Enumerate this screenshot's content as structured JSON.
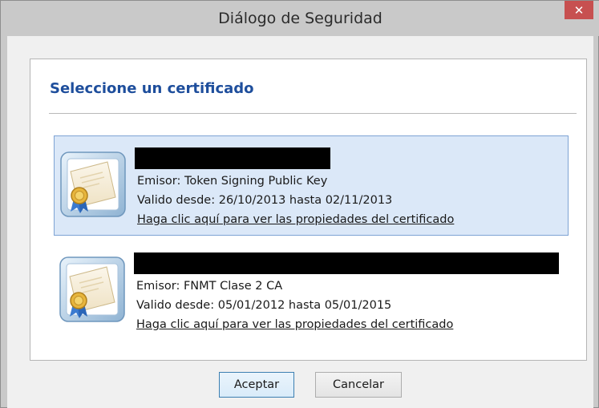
{
  "window": {
    "title": "Diálogo de Seguridad",
    "close_label": "✕"
  },
  "panel": {
    "heading": "Seleccione un certificado"
  },
  "certificates": [
    {
      "selected": true,
      "issuer": "Emisor: Token Signing Public Key",
      "validity": "Valido desde: 26/10/2013 hasta 02/11/2013",
      "link": "Haga clic aquí para ver las propiedades del certificado"
    },
    {
      "selected": false,
      "issuer": "Emisor: FNMT Clase 2 CA",
      "validity": "Valido desde: 05/01/2012 hasta 05/01/2015",
      "link": "Haga clic aquí para ver las propiedades del certificado"
    }
  ],
  "buttons": {
    "accept": "Aceptar",
    "cancel": "Cancelar"
  },
  "colors": {
    "heading": "#1e4e9c",
    "selection_bg": "#dbe8f8",
    "close_button": "#c75050"
  },
  "icons": {
    "certificate": "certificate-icon",
    "close": "close-icon"
  }
}
